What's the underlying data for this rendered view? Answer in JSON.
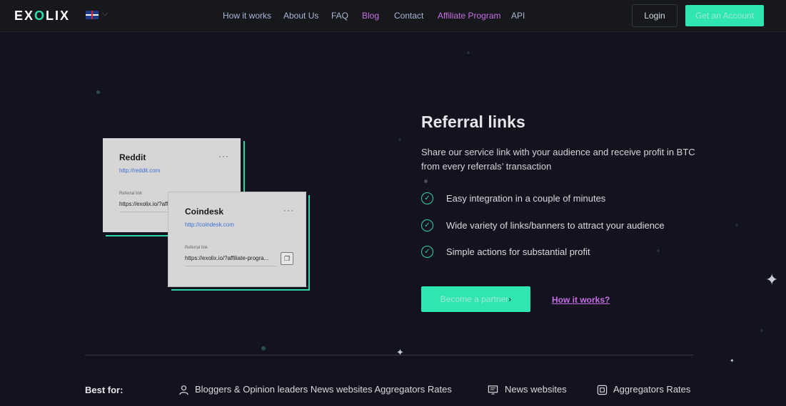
{
  "header": {
    "logo": "EXOLIX",
    "language_icon": "uk-flag-icon",
    "nav": [
      "How it works",
      "About Us",
      "FAQ",
      "Blog",
      "Contact",
      "Affiliate Program",
      "API"
    ],
    "login": "Login",
    "get_account": "Get an Account"
  },
  "cards": [
    {
      "title": "Reddit",
      "url": "http://reddit.com",
      "ref_label": "Referral link",
      "ref_link": "https://exolix.io/?affiliate-progra..."
    },
    {
      "title": "Coindesk",
      "url": "http://coindesk.com",
      "ref_label": "Referral link",
      "ref_link": "https://exolix.io/?affiliate-progra..."
    }
  ],
  "main": {
    "heading": "Referral links",
    "description": "Share our service link with your audience and receive profit in BTC from every referrals’ transaction",
    "features": [
      "Easy integration in a couple of minutes",
      "Wide variety of links/banners to attract your audience",
      "Simple actions for substantial profit"
    ],
    "become_partner": "Become a partner",
    "how_it_works": "How it works?"
  },
  "best_for": {
    "label": "Best for:",
    "items": [
      "Bloggers & Opinion leaders News websites Aggregators Rates",
      "News websites",
      "Aggregators Rates"
    ]
  },
  "colors": {
    "accent": "#2fe6b2",
    "pink": "#c86fe6",
    "background": "#13131f"
  }
}
